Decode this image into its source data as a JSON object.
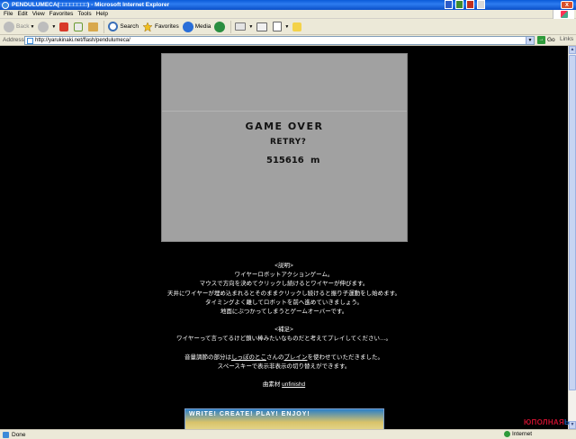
{
  "window": {
    "title": "PENDULUMECA(□□□□□□□□) - Microsoft Internet Explorer",
    "close_label": "x"
  },
  "menu": [
    "File",
    "Edit",
    "View",
    "Favorites",
    "Tools",
    "Help"
  ],
  "toolbar": {
    "back": "Back",
    "search": "Search",
    "favorites": "Favorites",
    "media": "Media"
  },
  "address": {
    "label": "Address",
    "url": "http://yarukinaki.net/flash/pendulumeca/",
    "go": "Go",
    "links": "Links"
  },
  "game": {
    "game_over": "GAME OVER",
    "retry": "RETRY?",
    "distance": "515616",
    "unit": "m"
  },
  "description": {
    "heading": "<説明>",
    "lines": [
      "ワイヤーロボットアクションゲーム。",
      "マウスで方向を決めてクリックし続けるとワイヤーが伸びます。",
      "天井にワイヤーが埋め込まれるとそのままクリックし続けると振り子運動をし始めます。",
      "タイミングよく離してロボットを前へ進めていきましょう。",
      "地面にぶつかってしまうとゲームオーバーです。"
    ],
    "note_heading": "<補足>",
    "note_line": "ワイヤーって言ってるけど鎖い棒みたいなものだと考えてプレイしてください…。",
    "credit_prefix": "音量調節の部分は",
    "credit_author": "しっぽのとこ",
    "credit_mid": "さんの",
    "credit_link": "ブレイン",
    "credit_suffix": "を使わせていただきました。",
    "space_line": "スペースキーで表示非表示の切り替えができます。",
    "material_prefix": "曲素材",
    "material_link": "unfinishd"
  },
  "banner": {
    "text": "WRITE! CREATE! PLAY! ENJOY!"
  },
  "status": {
    "text": "Done",
    "zone": "Internet"
  },
  "watermark": {
    "part1": "ЮПОЛНАЯ",
    "part2": "Ь"
  }
}
